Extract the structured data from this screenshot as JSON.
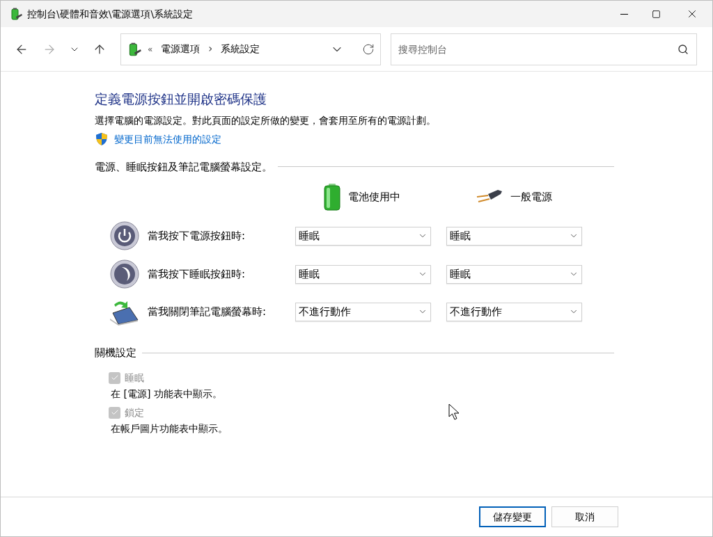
{
  "window": {
    "title": "控制台\\硬體和音效\\電源選項\\系統設定"
  },
  "nav": {
    "breadcrumb_prefix": "«",
    "breadcrumbs": [
      "電源選項",
      "系統設定"
    ],
    "separator": "›",
    "search": {
      "placeholder": "搜尋控制台"
    }
  },
  "heading": "定義電源按鈕並開啟密碼保護",
  "description": "選擇電腦的電源設定。對此頁面的設定所做的變更，會套用至所有的電源計劃。",
  "admin_link": "變更目前無法使用的設定",
  "buttons_section": {
    "title": "電源、睡眠按鈕及筆記電腦螢幕設定。",
    "columns": [
      {
        "kind": "battery",
        "label": "電池使用中"
      },
      {
        "kind": "plug",
        "label": "一般電源"
      }
    ],
    "rows": [
      {
        "kind": "power",
        "label": "當我按下電源按鈕時:",
        "values": [
          "睡眠",
          "睡眠"
        ]
      },
      {
        "kind": "sleep",
        "label": "當我按下睡眠按鈕時:",
        "values": [
          "睡眠",
          "睡眠"
        ]
      },
      {
        "kind": "lid",
        "label": "當我關閉筆記電腦螢幕時:",
        "values": [
          "不進行動作",
          "不進行動作"
        ]
      }
    ]
  },
  "shutdown_section": {
    "title": "關機設定",
    "options": [
      {
        "label": "睡眠",
        "description": "在 [電源] 功能表中顯示。",
        "checked": true,
        "disabled": true
      },
      {
        "label": "鎖定",
        "description": "在帳戶圖片功能表中顯示。",
        "checked": true,
        "disabled": true
      }
    ]
  },
  "footer_buttons": [
    {
      "label": "儲存變更",
      "primary": true
    },
    {
      "label": "取消",
      "primary": false
    }
  ]
}
